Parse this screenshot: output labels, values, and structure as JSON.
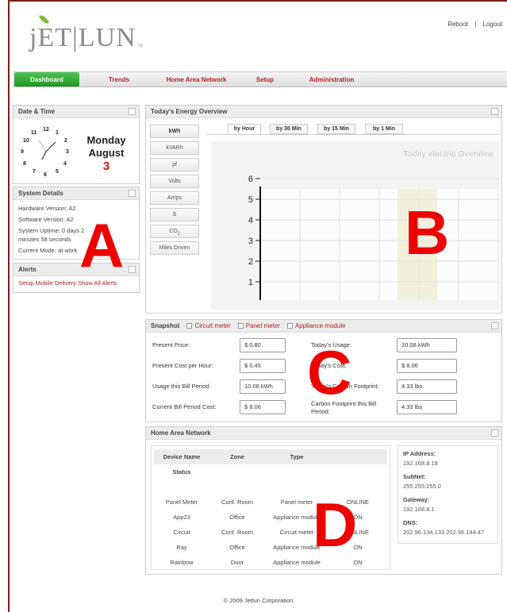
{
  "brand": {
    "name": "jET|LUN",
    "tm": "TM"
  },
  "top_links": {
    "reboot": "Reboot",
    "sep": "|",
    "logout": "Logout"
  },
  "nav": [
    {
      "label": "Dashboard",
      "active": true
    },
    {
      "label": "Trends"
    },
    {
      "label": "Home Area Network"
    },
    {
      "label": "Setup"
    },
    {
      "label": "Administration"
    }
  ],
  "datetime": {
    "title": "Date & Time",
    "clock_numbers": [
      "12",
      "1",
      "2",
      "3",
      "4",
      "5",
      "6",
      "7",
      "8",
      "9",
      "10",
      "11"
    ],
    "day": "Monday",
    "month": "August",
    "date": "3"
  },
  "system": {
    "title": "System Details",
    "hardware": "Hardware Version: A2",
    "software": "Software Version: A2",
    "uptime": "System Uptime: 0 days 2",
    "uptime2": "minutes 58 seconds",
    "mode": "Current Mode: at work"
  },
  "alerts": {
    "title": "Alerts",
    "setup": "Setup Mobile Delivery",
    "show_all": "Show All Alerts"
  },
  "energy": {
    "title": "Today's Energy Overview",
    "units": [
      "kWh",
      "kVARh",
      "pf",
      "Volts",
      "Amps",
      "$",
      "CO2",
      "Miles Driven"
    ],
    "tabs": [
      "by Hour",
      "by 30 Min",
      "by 15 Min",
      "by 1 Min"
    ],
    "active_tab": "by Hour",
    "chart_title": "Today electric Overview"
  },
  "chart_data": {
    "type": "bar",
    "title": "Today electric Overview",
    "y_ticks": [
      1,
      2,
      3,
      4,
      5,
      6
    ],
    "ylim": [
      0,
      6
    ],
    "grid": true,
    "series": []
  },
  "snapshot": {
    "title": "Snapshot",
    "legend": [
      "Circuit meter",
      "Panel meter",
      "Appliance module"
    ],
    "fields": [
      {
        "label": "Present Price:",
        "value": "$ 0.80"
      },
      {
        "label": "Present Cost per Hour:",
        "value": "$ 0.45"
      },
      {
        "label": "Usage this Bill Period:",
        "value": "10.08 kWh"
      },
      {
        "label": "Current Bill Period Cost:",
        "value": "$ 8.06"
      },
      {
        "label": "Today's Usage:",
        "value": "10.08 kWh"
      },
      {
        "label": "Today's Cost:",
        "value": "$ 8.06"
      },
      {
        "label": "Today's Carbon Footprint:",
        "value": "4.33 lbs"
      },
      {
        "label": "Carbon Footprint this Bill Period:",
        "value": "4.33 lbs"
      }
    ]
  },
  "han": {
    "title": "Home Area Network",
    "headers": [
      "Device Name",
      "Zone",
      "Type",
      "Status"
    ],
    "rows": [
      [
        "Panel Meter",
        "Conf. Room",
        "Panel meter",
        "ONLINE"
      ],
      [
        "App23",
        "Office",
        "Appliance module",
        "ON"
      ],
      [
        "Circuit",
        "Conf. Room",
        "Circuit meter",
        "ONLINE"
      ],
      [
        "Ray",
        "Office",
        "Appliance module",
        "ON"
      ],
      [
        "Rainbow",
        "Door",
        "Appliance module",
        "ON"
      ]
    ],
    "ip_label": "IP Address:",
    "ip": "192.168.8.18",
    "subnet_label": "SubNet:",
    "subnet": "255.255.255.0",
    "gateway_label": "Gateway:",
    "gateway": "192.168.8.1",
    "dns_label": "DNS:",
    "dns": "202.96.134.133 202.96.144.47"
  },
  "overlay_letters": [
    "A",
    "B",
    "C",
    "D"
  ],
  "footer": "© 2009 Jetlun Corporation.",
  "colors": {
    "accent": "#b21f1f",
    "nav_active": "#2ea52a",
    "annotation": "#ee0000",
    "date": "#d61b0e"
  }
}
